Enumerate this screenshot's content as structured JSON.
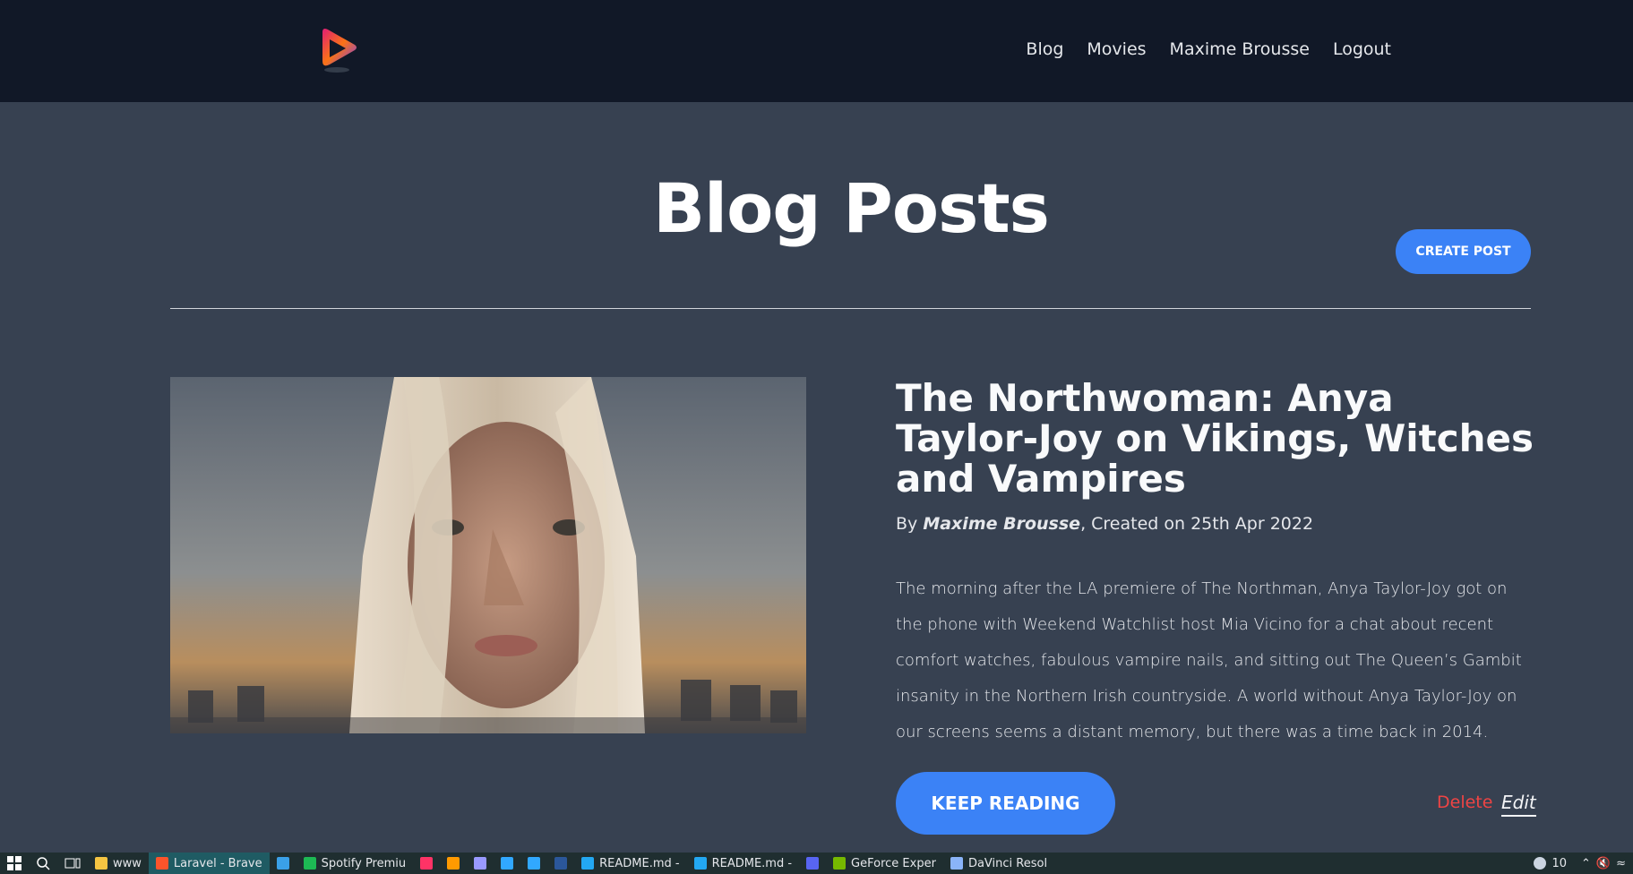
{
  "nav": {
    "items": [
      "Blog",
      "Movies",
      "Maxime Brousse",
      "Logout"
    ]
  },
  "page": {
    "title": "Blog Posts",
    "create_label": "Create post"
  },
  "post": {
    "title": "The Northwoman: Anya Taylor-Joy on Vikings, Witches and Vampires",
    "by": "By",
    "author": "Maxime Brousse",
    "created": ", Created on 25th Apr 2022",
    "excerpt": "The morning after the LA premiere of The Northman, Anya Taylor-Joy got on the phone with Weekend Watchlist host Mia Vicino for a chat about recent comfort watches, fabulous vampire nails, and sitting out The Queen’s Gambit insanity in the Northern Irish countryside. A world without Anya Taylor-Joy on our screens seems a distant memory, but there was a time back in 2014.",
    "keep_reading_label": "Keep Reading",
    "delete_label": "Delete",
    "edit_label": "Edit"
  },
  "taskbar": {
    "items": [
      {
        "label": "www",
        "icon": "folder-icon",
        "color": "#f5c542"
      },
      {
        "label": "Laravel - Brave",
        "icon": "brave-icon",
        "color": "#fb542b",
        "active": true
      },
      {
        "label": "",
        "icon": "edge-icon",
        "color": "#3aa0e8"
      },
      {
        "label": "Spotify Premiu",
        "icon": "spotify-icon",
        "color": "#1db954"
      },
      {
        "label": "",
        "icon": "indesign-icon",
        "color": "#ff3366"
      },
      {
        "label": "",
        "icon": "illustrator-icon",
        "color": "#ff9a00"
      },
      {
        "label": "",
        "icon": "after-effects-icon",
        "color": "#9999ff"
      },
      {
        "label": "",
        "icon": "lightroom-icon",
        "color": "#31a8ff"
      },
      {
        "label": "",
        "icon": "photoshop-icon",
        "color": "#31a8ff"
      },
      {
        "label": "",
        "icon": "word-icon",
        "color": "#2b579a"
      },
      {
        "label": "README.md -",
        "icon": "vscode-icon",
        "color": "#23a8f2"
      },
      {
        "label": "README.md -",
        "icon": "vscode-icon",
        "color": "#23a8f2"
      },
      {
        "label": "",
        "icon": "discord-icon",
        "color": "#5865f2"
      },
      {
        "label": "GeForce Exper",
        "icon": "nvidia-icon",
        "color": "#76b900"
      },
      {
        "label": "DaVinci Resol",
        "icon": "davinci-icon",
        "color": "#8ab4f8"
      }
    ],
    "weather": "10"
  }
}
